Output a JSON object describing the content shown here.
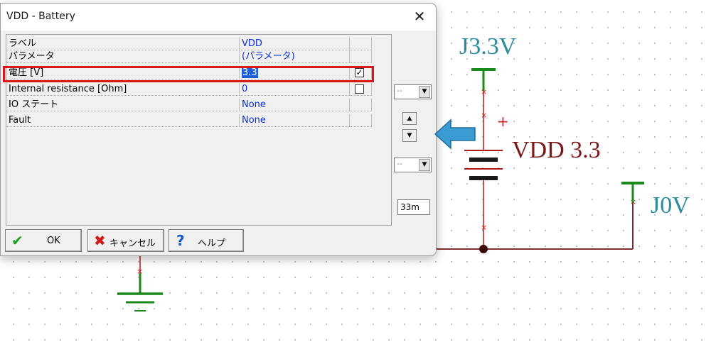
{
  "dialog": {
    "title": "VDD - Battery",
    "close_glyph": "✕",
    "rows": [
      {
        "name": "ラベル",
        "value": "VDD",
        "checkbox": null
      },
      {
        "name": "パラメータ",
        "value": "(パラメータ)",
        "checkbox": null
      },
      {
        "name": "電圧 [V]",
        "value": "3.3",
        "checkbox": true
      },
      {
        "name": "Internal resistance [Ohm]",
        "value": "0",
        "checkbox": false
      },
      {
        "name": "IO ステート",
        "value": "None",
        "checkbox": null
      },
      {
        "name": "Fault",
        "value": "None",
        "checkbox": null
      }
    ],
    "side": {
      "combo1_value": "--",
      "combo2_value": "--",
      "step_input": "33m"
    },
    "buttons": {
      "ok_label": "OK",
      "cancel_label": "キャンセル",
      "help_label": "ヘルプ"
    }
  },
  "schematic": {
    "top_label": "J3.3V",
    "battery_label": "VDD 3.3",
    "gnd_label": "J0V",
    "plus_sign": "+"
  },
  "colors": {
    "wire": "#b01818",
    "wire_dark": "#6a1010",
    "power_symbol": "#1a8a1a",
    "label_teal": "#2a8c9c",
    "label_maroon": "#7a1818",
    "highlight": "#d81818",
    "arrow": "#3a9bd2"
  }
}
